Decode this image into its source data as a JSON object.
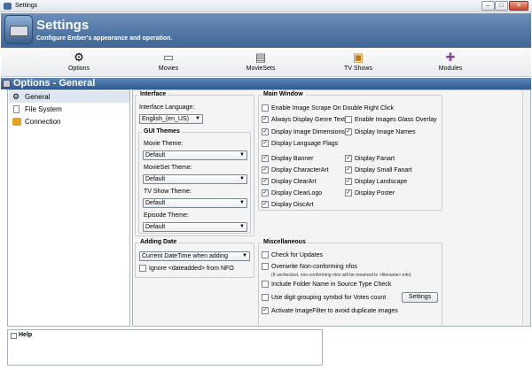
{
  "window": {
    "title": "Settings",
    "controls": {
      "minimize": "–",
      "maximize": "□",
      "close": "✕"
    }
  },
  "header": {
    "title": "Settings",
    "subtitle": "Configure Ember's appearance and operation."
  },
  "nav": [
    {
      "label": "Options",
      "icon": "gear-icon"
    },
    {
      "label": "Movies",
      "icon": "film-icon"
    },
    {
      "label": "MovieSets",
      "icon": "filmstrip-icon"
    },
    {
      "label": "TV Shows",
      "icon": "tv-icon"
    },
    {
      "label": "Modules",
      "icon": "puzzle-icon"
    }
  ],
  "options_bar": {
    "title": "Options - General"
  },
  "tree": [
    {
      "label": "General",
      "icon": "gear-icon"
    },
    {
      "label": "File System",
      "icon": "document-icon"
    },
    {
      "label": "Connection",
      "icon": "connection-icon"
    }
  ],
  "interface": {
    "title": "Interface",
    "language_label": "Interface Language:",
    "language_value": "English_(en_US)",
    "gui_themes": {
      "title": "GUI Themes",
      "movie_label": "Movie Theme:",
      "movie_value": "Default",
      "movieset_label": "MovieSet Theme:",
      "movieset_value": "Default",
      "tvshow_label": "TV Show Theme:",
      "tvshow_value": "Default",
      "episode_label": "Episode Theme:",
      "episode_value": "Default"
    }
  },
  "adding_date": {
    "title": "Adding Date",
    "select_value": "Current DateTime when adding",
    "ignore_label": "Ignore <dateadded> from NFO"
  },
  "main_window": {
    "title": "Main Window",
    "checks": [
      {
        "label": "Enable Image Scrape On Double Right Click",
        "checked": false
      },
      {
        "label": "Always Display Genre Text",
        "checked": true
      },
      {
        "label": "Enable Images Glass Overlay",
        "checked": false
      },
      {
        "label": "Display Image Dimensions",
        "checked": true
      },
      {
        "label": "Display Image Names",
        "checked": true
      },
      {
        "label": "Display Language Flags",
        "checked": true
      },
      {
        "label": "Display Banner",
        "checked": true
      },
      {
        "label": "Display Fanart",
        "checked": true
      },
      {
        "label": "Display CharacterArt",
        "checked": true
      },
      {
        "label": "Display Small Fanart",
        "checked": true
      },
      {
        "label": "Display ClearArt",
        "checked": true
      },
      {
        "label": "Display Landscape",
        "checked": true
      },
      {
        "label": "Display ClearLogo",
        "checked": true
      },
      {
        "label": "Display Poster",
        "checked": true
      },
      {
        "label": "Display DiscArt",
        "checked": true
      }
    ]
  },
  "misc": {
    "title": "Miscellaneous",
    "check_updates": "Check for Updates",
    "overwrite_nfo": "Overwrite Non-conforming nfos",
    "overwrite_note": "(If unchecked, non-conforming nfos will be renamed to <filename>.info)",
    "include_folder": "Include Folder Name in Source Type Check",
    "digit_grouping": "Use digit grouping symbol for Votes count",
    "settings_button": "Settings",
    "image_filter": "Activate ImageFilter to avoid duplicate images"
  },
  "help": {
    "title": "Help"
  }
}
